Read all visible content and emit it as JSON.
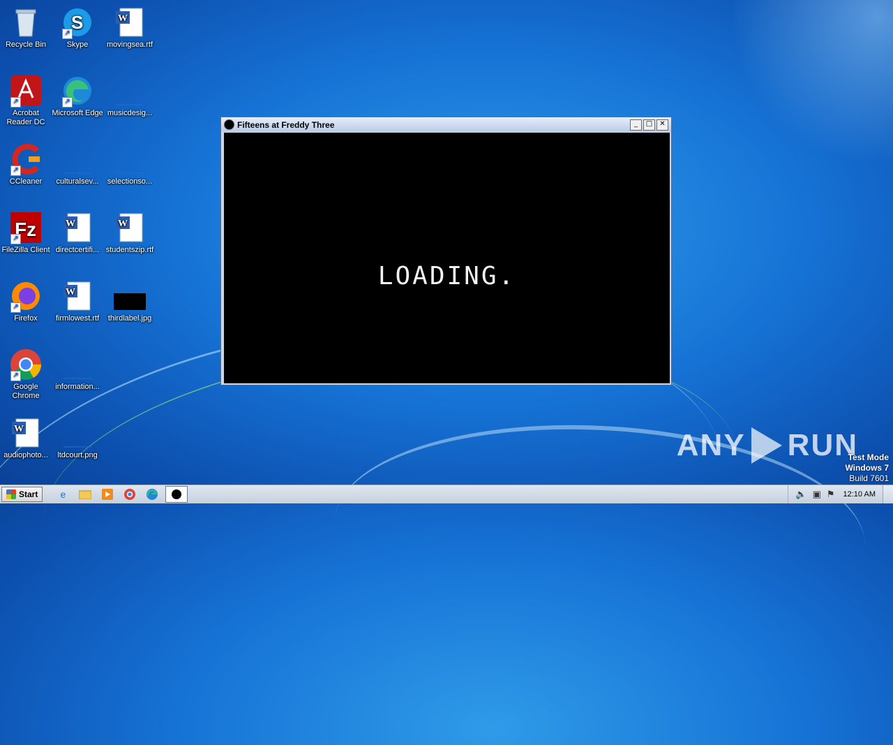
{
  "desktop": {
    "icons": [
      {
        "label": "Recycle Bin",
        "icon": "recycle-bin-icon"
      },
      {
        "label": "Skype",
        "icon": "skype-icon"
      },
      {
        "label": "movingsea.rtf",
        "icon": "word-document-icon"
      },
      {
        "label": "Acrobat Reader DC",
        "icon": "acrobat-reader-icon"
      },
      {
        "label": "Microsoft Edge",
        "icon": "edge-icon"
      },
      {
        "label": "musicdesig...",
        "icon": "blank-file-icon"
      },
      {
        "label": "CCleaner",
        "icon": "ccleaner-icon"
      },
      {
        "label": "culturalsev...",
        "icon": "blank-file-icon"
      },
      {
        "label": "selectionso...",
        "icon": "blank-file-icon"
      },
      {
        "label": "FileZilla Client",
        "icon": "filezilla-icon"
      },
      {
        "label": "directcertifi...",
        "icon": "word-document-icon"
      },
      {
        "label": "studentszip.rtf",
        "icon": "word-document-icon"
      },
      {
        "label": "Firefox",
        "icon": "firefox-icon"
      },
      {
        "label": "firmlowest.rtf",
        "icon": "word-document-icon"
      },
      {
        "label": "thirdlabel.jpg",
        "icon": "image-thumbnail-icon"
      },
      {
        "label": "Google Chrome",
        "icon": "chrome-icon"
      },
      {
        "label": "information...",
        "icon": "blank-file-icon"
      },
      {
        "label": "audiophoto...",
        "icon": "word-document-icon"
      },
      {
        "label": "ltdcourt.png",
        "icon": "blank-file-icon"
      }
    ]
  },
  "window": {
    "title": "Fifteens at Freddy Three",
    "minimize": "_",
    "maximize": "□",
    "close": "✕",
    "content_text": "LOADING."
  },
  "watermark": {
    "brand_left": "ANY",
    "brand_right": "RUN"
  },
  "os_info": {
    "line1": "Test Mode",
    "line2": "Windows 7",
    "line3": "Build 7601"
  },
  "taskbar": {
    "start_label": "Start",
    "clock": "12:10 AM"
  }
}
